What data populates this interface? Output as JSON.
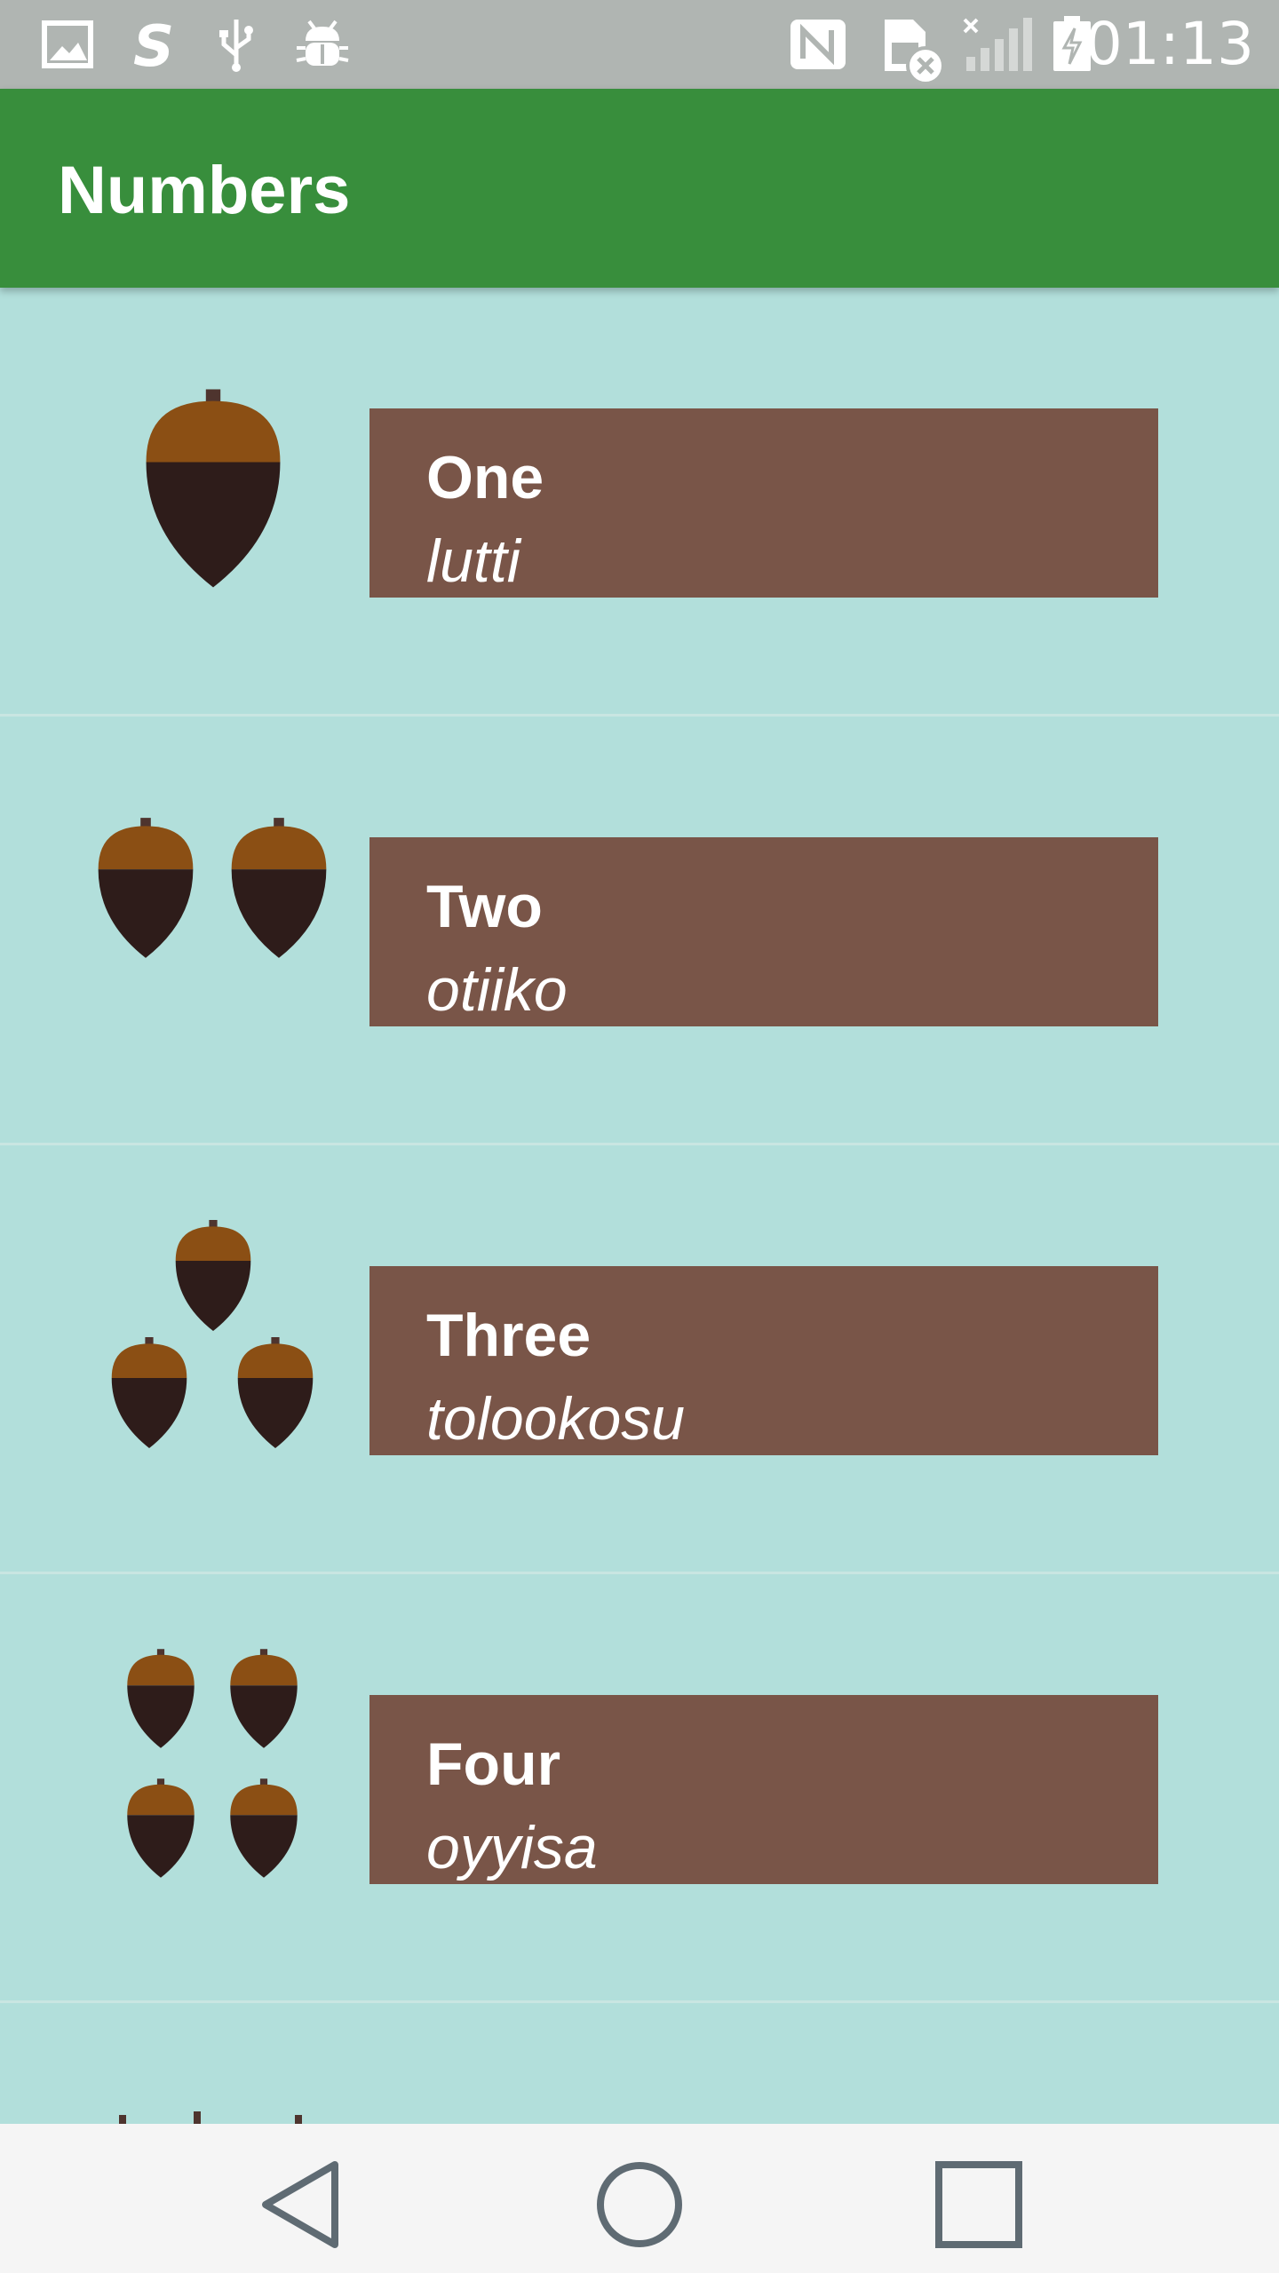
{
  "status_bar": {
    "time": "01:13",
    "icons": [
      "gallery-icon",
      "s-app-icon",
      "usb-icon",
      "debug-icon",
      "nfc-icon",
      "no-sim-icon",
      "signal-off-icon",
      "battery-charging-icon"
    ]
  },
  "app_bar": {
    "title": "Numbers"
  },
  "items": [
    {
      "english": "One",
      "translation": "lutti",
      "count": 1
    },
    {
      "english": "Two",
      "translation": "otiiko",
      "count": 2
    },
    {
      "english": "Three",
      "translation": "tolookosu",
      "count": 3
    },
    {
      "english": "Four",
      "translation": "oyyisa",
      "count": 4
    }
  ],
  "nav_bar": {
    "buttons": [
      "back-icon",
      "home-icon",
      "recents-icon"
    ]
  },
  "colors": {
    "status_bar": "#b0b5b2",
    "app_bar": "#388e3c",
    "background": "#b2dfdb",
    "card": "#795548",
    "acorn_cap": "#8b4f14",
    "acorn_body": "#2e1c1a"
  }
}
